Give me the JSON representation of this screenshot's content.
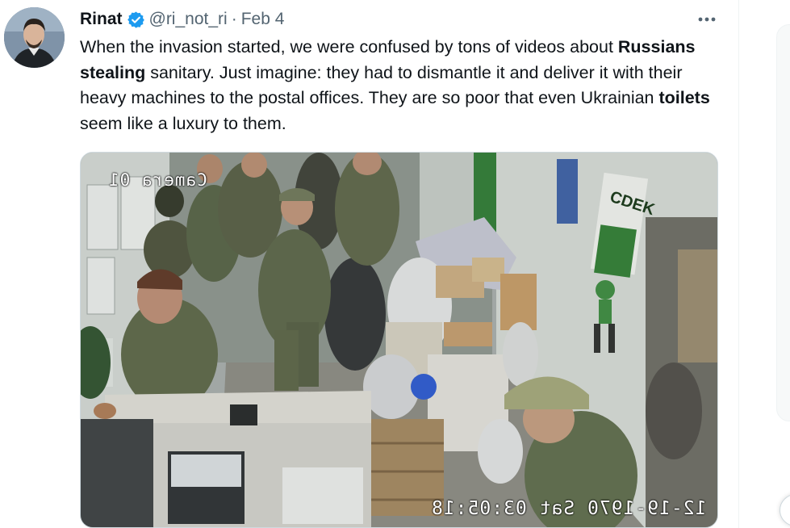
{
  "tweet": {
    "display_name": "Rinat",
    "handle": "@ri_not_ri",
    "separator": "·",
    "date": "Feb 4",
    "more_icon": "more-horizontal-icon",
    "verified_icon": "verified-badge-icon",
    "text": {
      "p1": "When the invasion started, we were confused by tons of videos about ",
      "b1": "Russians stealing",
      "p2": " sanitary. Just imagine: they had to dismantle it and deliver it with their heavy machines to the postal offices. They are so poor that even Ukrainian ",
      "b2": "toilets",
      "p3": " seem like a luxury to them."
    }
  },
  "media": {
    "camera_label": "Camera 01",
    "timestamp": "12-19-1970 Sat 03:05:18",
    "sign_text": "CDEK"
  },
  "colors": {
    "verified_blue": "#1d9bf0",
    "secondary_text": "#536471",
    "primary_text": "#0f1419"
  }
}
